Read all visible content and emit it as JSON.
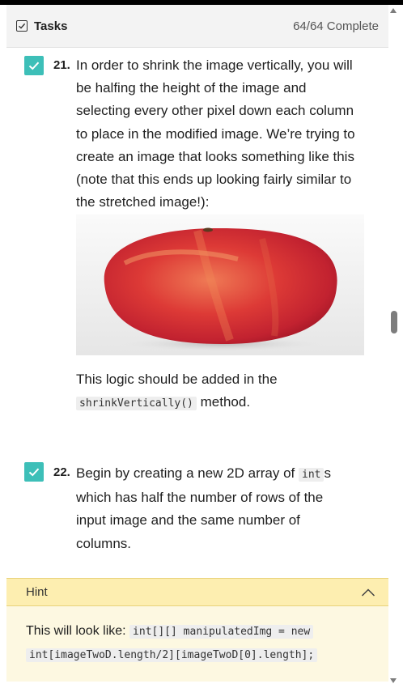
{
  "header": {
    "title": "Tasks",
    "progress": "64/64 Complete"
  },
  "tasks": [
    {
      "number": "21.",
      "lines": [
        "In order to shrink the image vertically, you will",
        "be halfing the height of the image and",
        "selecting every other pixel down each column",
        "to place in the modified image. We’re trying to",
        "create an image that looks something like this",
        "(note that this ends up looking fairly similar to",
        "the stretched image!):"
      ],
      "after_text": "This logic should be added in the",
      "code": "shrinkVertically()",
      "after_code": "method."
    },
    {
      "number": "22.",
      "line1_before": "Begin by creating a new 2D array of",
      "line1_code": "int",
      "line1_after": "s",
      "lines": [
        "which has half the number of rows of the",
        "input image and the same number of",
        "columns."
      ]
    }
  ],
  "hint": {
    "label": "Hint",
    "prefix": "This will look like:",
    "code1": "int[][] manipulatedImg = new",
    "code2": "int[imageTwoD.length/2][imageTwoD[0].length];"
  },
  "colors": {
    "check": "#3dbfb8",
    "hint_header": "#fdeeb0",
    "hint_body": "#fdf8e1"
  }
}
